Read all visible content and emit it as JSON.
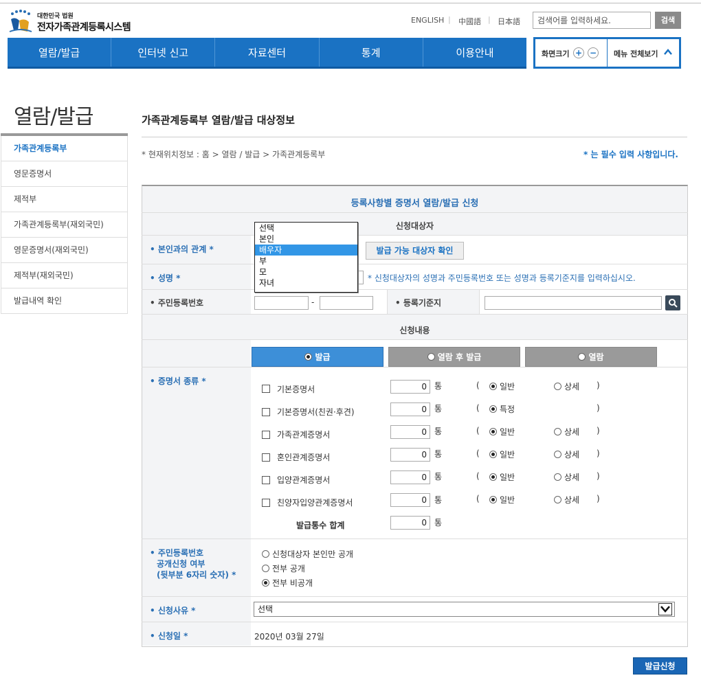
{
  "header": {
    "logo_sub": "대한민국 법원",
    "logo_main": "전자가족관계등록시스템",
    "lang": [
      "ENGLISH",
      "中國語",
      "日本語"
    ],
    "search_placeholder": "검색어를 입력하세요.",
    "search_label": "검색"
  },
  "nav": {
    "items": [
      "열람/발급",
      "인터넷 신고",
      "자료센터",
      "통계",
      "이용안내"
    ],
    "zoom_label": "화면크기",
    "zoom_in": "+",
    "zoom_out": "−",
    "all_menu_label": "메뉴 전체보기"
  },
  "sidebar": {
    "title": "열람/발급",
    "items": [
      "가족관계등록부",
      "영문증명서",
      "제적부",
      "가족관계등록부(재외국민)",
      "영문증명서(재외국민)",
      "제적부(재외국민)",
      "발급내역 확인"
    ]
  },
  "content": {
    "title": "가족관계등록부 열람/발급 대상정보",
    "location": "* 현재위치정보 : 홈 > 열람 / 발급 > 가족관계등록부",
    "required_note": "* 는 필수 입력 사항입니다."
  },
  "form": {
    "heading": "등록사항별 증명서 열람/발급 신청",
    "target_section": "신청대상자",
    "relation_label": "• 본인과의 관계 *",
    "relation_options": [
      "선택",
      "본인",
      "배우자",
      "부",
      "모",
      "자녀"
    ],
    "relation_selected": "배우자",
    "check_target_button": "발급 가능 대상자 확인",
    "name_label": "• 성명 *",
    "name_hint": "* 신청대상자의 성명과 주민등록번호 또는 성명과 등록기준지를 입력하십시오.",
    "rrn_label": "• 주민등록번호",
    "rrn_sep": "-",
    "base_label": "• 등록기준지",
    "content_section": "신청내용",
    "tabs": [
      "발급",
      "열람 후 발급",
      "열람"
    ],
    "tab_selected": "발급",
    "cert_type_label": "• 증명서 종류 *",
    "count_unit": "통",
    "option_general": "일반",
    "option_detail": "상세",
    "option_specific": "특정",
    "paren_open": "(",
    "paren_close": ")",
    "certificates": [
      {
        "name": "기본증명서",
        "count": "0"
      },
      {
        "name": "기본증명서(친권·후견)",
        "count": "0"
      },
      {
        "name": "가족관계증명서",
        "count": "0"
      },
      {
        "name": "혼인관계증명서",
        "count": "0"
      },
      {
        "name": "입양관계증명서",
        "count": "0"
      },
      {
        "name": "친양자입양관계증명서",
        "count": "0"
      }
    ],
    "total_label": "발급통수 합계",
    "total_count": "0",
    "disclose_label_1": "• 주민등록번호",
    "disclose_label_2": "공개신청 여부",
    "disclose_label_3": "(뒷부분 6자리 숫자) *",
    "disclose_options": [
      "신청대상자 본인만 공개",
      "전부 공개",
      "전부 비공개"
    ],
    "disclose_selected": "전부 비공개",
    "reason_label": "• 신청사유 *",
    "reason_value": "선택",
    "date_label": "• 신청일 *",
    "date_value": "2020년 03월 27일",
    "submit_label": "발급신청"
  },
  "colors": {
    "primary": "#1a72c3",
    "selected_option": "#3296e6",
    "tab_off": "#9a9a9a"
  }
}
